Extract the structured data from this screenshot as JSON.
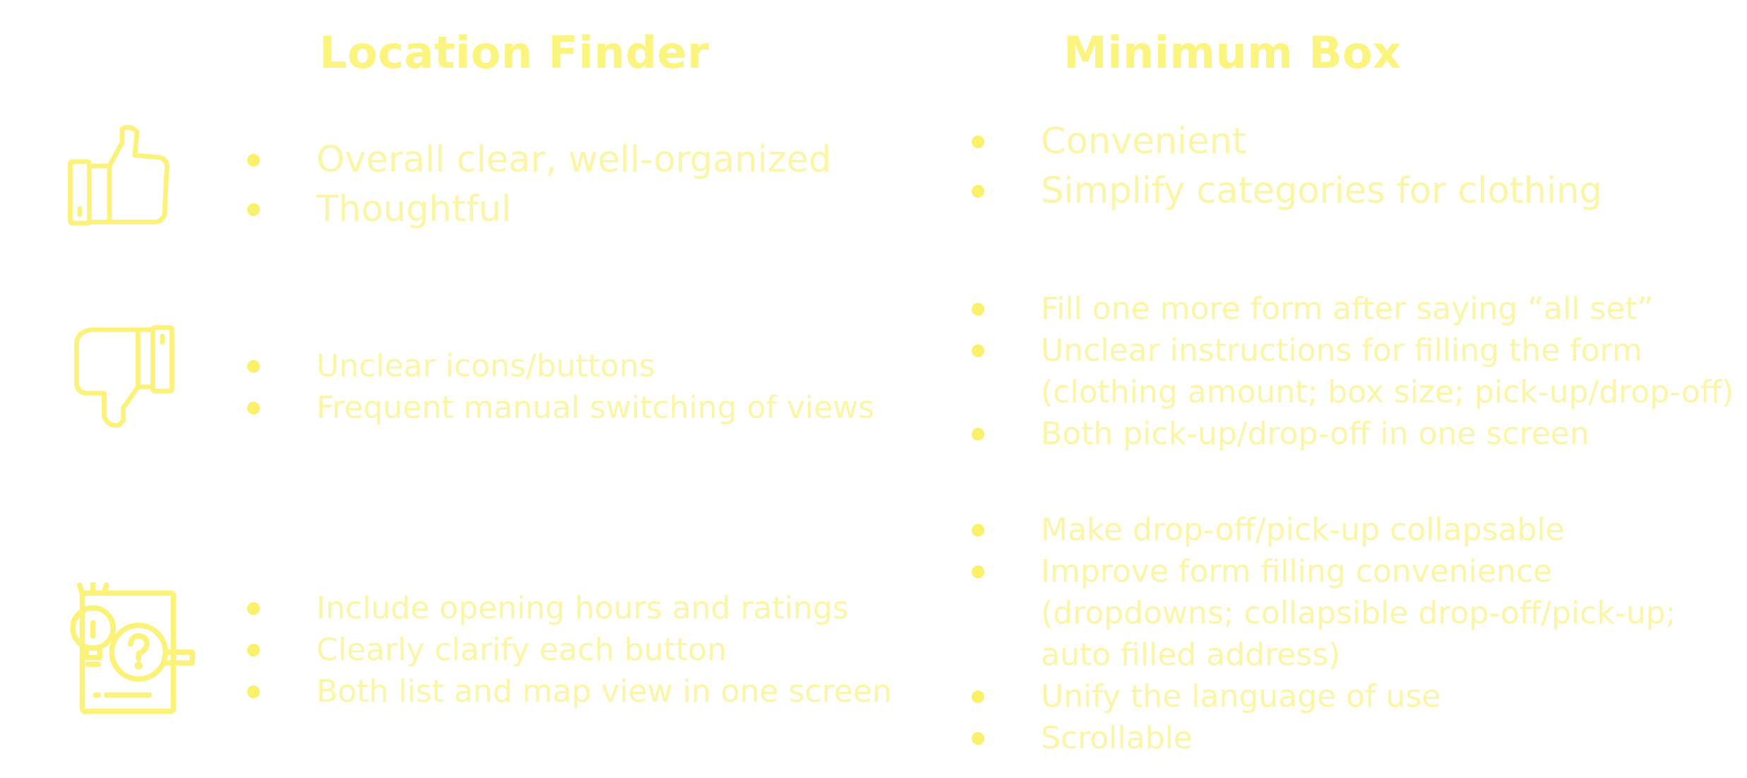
{
  "colors": {
    "title": "#fbf47f",
    "text": "#fbf6a6",
    "bullet": "#fbf06a",
    "icon": "#fbf27a"
  },
  "icons": {
    "positive": "thumbs-up-icon",
    "negative": "thumbs-down-icon",
    "suggestions": "lightbulb-question-icon"
  },
  "left": {
    "title": "Location Finder",
    "positives": [
      "Overall clear, well-organized",
      "Thoughtful"
    ],
    "negatives": [
      "Unclear icons/buttons",
      "Frequent manual switching of views"
    ],
    "suggestions": [
      "Include opening hours and ratings",
      "Clearly clarify each button",
      "Both list and map view in one screen"
    ]
  },
  "right": {
    "title": "Minimum Box",
    "positives": [
      "Convenient",
      "Simplify categories for clothing"
    ],
    "negatives": [
      "Fill one more form after saying “all set”",
      "Unclear instructions for filling the form\n(clothing amount; box size; pick-up/drop-off)",
      "Both pick-up/drop-off in one screen"
    ],
    "suggestions": [
      "Make drop-off/pick-up collapsable",
      "Improve form filling convenience\n(dropdowns; collapsible drop-off/pick-up;\nauto filled address)",
      "Unify the language of use",
      "Scrollable"
    ]
  }
}
